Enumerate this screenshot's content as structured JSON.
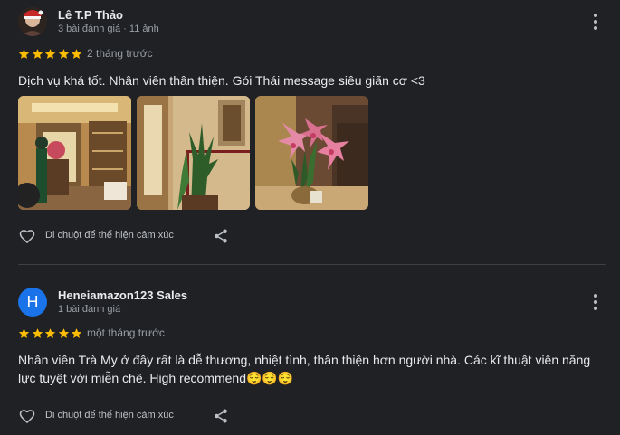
{
  "reviews": [
    {
      "author": "Lê T.P Thảo",
      "meta": "3 bài đánh giá · 11 ảnh",
      "rating": 5,
      "time": "2 tháng trước",
      "text": "Dịch vụ khá tốt. Nhân viên thân thiện. Gói Thái message siêu giãn cơ <3",
      "photos": [
        "lobby-photo",
        "hallway-plant-photo",
        "lily-flowers-photo"
      ],
      "reaction_hint": "Di chuột để thể hiện cảm xúc"
    },
    {
      "author": "Heneiamazon123 Sales",
      "avatar_letter": "H",
      "meta": "1 bài đánh giá",
      "rating": 5,
      "time": "một tháng trước",
      "text": "Nhân viên Trà My ở đây rất là dễ thương, nhiệt tình, thân thiện hơn người nhà. Các kĩ thuật viên năng lực tuyệt vời miễn chê. High recommend",
      "emoji": "😌😌😌",
      "reaction_hint": "Di chuột để thể hiện cảm xúc"
    }
  ],
  "colors": {
    "background": "#202124",
    "star": "#fbbc04",
    "avatar_blue": "#1a73e8",
    "text_primary": "#e8eaed",
    "text_secondary": "#9aa0a6"
  },
  "icons": [
    "more-vert-icon",
    "star-icon",
    "heart-outline-icon",
    "share-icon",
    "relieved-face-emoji"
  ]
}
